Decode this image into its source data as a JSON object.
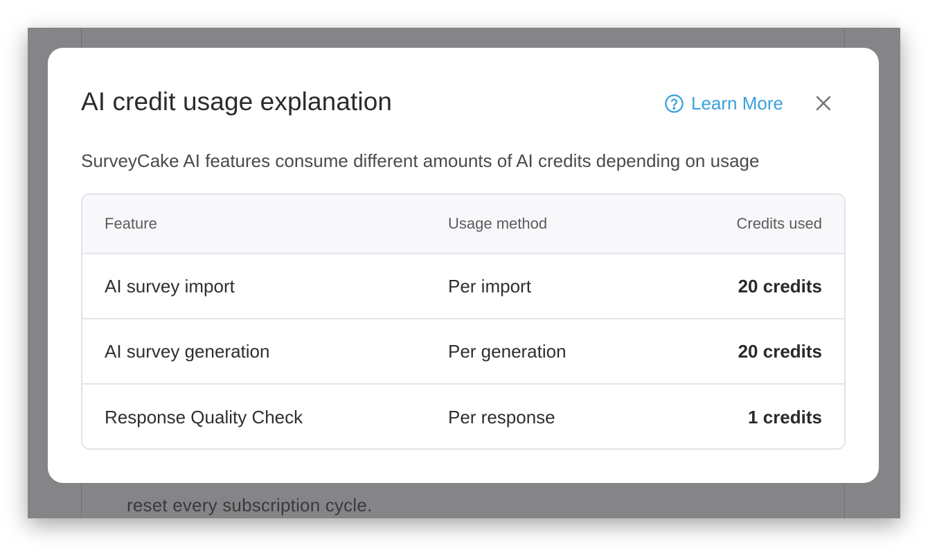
{
  "background": {
    "text": "reset every subscription cycle."
  },
  "modal": {
    "title": "AI credit usage explanation",
    "learn_more_label": "Learn More",
    "subtitle": "SurveyCake AI features consume different amounts of AI credits depending on usage",
    "accent_color": "#3aa0dd",
    "table": {
      "headers": [
        "Feature",
        "Usage method",
        "Credits used"
      ],
      "rows": [
        [
          "AI survey import",
          "Per import",
          "20 credits"
        ],
        [
          "AI survey generation",
          "Per generation",
          "20 credits"
        ],
        [
          "Response Quality Check",
          "Per response",
          "1 credits"
        ]
      ]
    }
  },
  "icons": {
    "learn_more": "help-circle-icon",
    "close": "close-icon"
  }
}
